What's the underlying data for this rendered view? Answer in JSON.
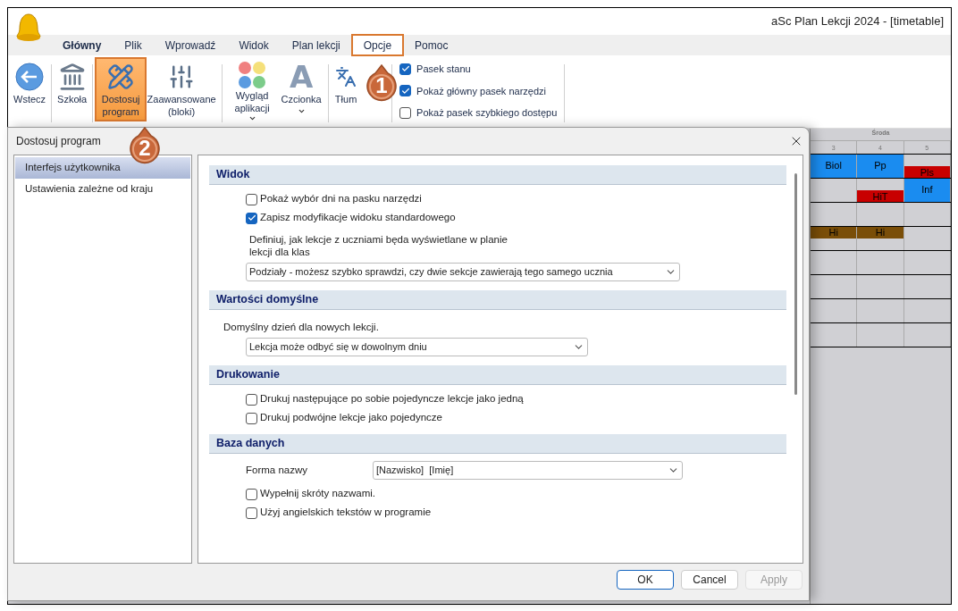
{
  "window": {
    "title": "aSc Plan Lekcji 2024  - [timetable]"
  },
  "ribbon_tabs": [
    {
      "label": "Główny",
      "selected": true,
      "highlighted": false
    },
    {
      "label": "Plik",
      "selected": false,
      "highlighted": false
    },
    {
      "label": "Wprowadź",
      "selected": false,
      "highlighted": false
    },
    {
      "label": "Widok",
      "selected": false,
      "highlighted": false
    },
    {
      "label": "Plan lekcji",
      "selected": false,
      "highlighted": false
    },
    {
      "label": "Opcje",
      "selected": false,
      "highlighted": true
    },
    {
      "label": "Pomoc",
      "selected": false,
      "highlighted": false
    }
  ],
  "ribbon_buttons": [
    {
      "kind": "back",
      "label": "Wstecz",
      "highlighted": false,
      "menu": false
    },
    {
      "kind": "school",
      "label": "Szkoła",
      "highlighted": false,
      "menu": false
    },
    {
      "kind": "customize",
      "label": "Dostosuj program",
      "highlighted": true,
      "menu": false
    },
    {
      "kind": "advanced",
      "label": "Zaawansowane (bloki)",
      "highlighted": false,
      "menu": false
    },
    {
      "kind": "appearance",
      "label": "Wygląd aplikacji",
      "highlighted": false,
      "menu": true
    },
    {
      "kind": "font",
      "label": "Czcionka",
      "glyph": "A",
      "highlighted": false,
      "menu": true
    },
    {
      "kind": "translate",
      "label": "Tłum",
      "highlighted": false,
      "menu": false
    }
  ],
  "ribbon_checkboxes": [
    {
      "label": "Pasek stanu",
      "checked": true
    },
    {
      "label": "Pokaż główny pasek narzędzi",
      "checked": true
    },
    {
      "label": "Pokaż pasek szybkiego dostępu",
      "checked": false
    }
  ],
  "timetable": {
    "day": "Środa",
    "periods": [
      "3",
      "4",
      "5"
    ],
    "rows": [
      [
        {
          "label": "Biol",
          "color": "#1a8cf0",
          "kind": "full"
        },
        {
          "label": "Pp",
          "color": "#1a8cf0",
          "kind": "full"
        },
        {
          "label": "Pls",
          "color": "#c80000",
          "kind": "bottom"
        }
      ],
      [
        {},
        {
          "label": "HiT",
          "color": "#c80000",
          "kind": "bottom"
        },
        {
          "label": "Inf",
          "color": "#1a8cf0",
          "kind": "full"
        }
      ],
      [
        {},
        {},
        {}
      ],
      [
        {
          "label": "Hi",
          "color": "#7a4e08",
          "kind": "top"
        },
        {
          "label": "Hi",
          "color": "#7a4e08",
          "kind": "top"
        },
        {}
      ],
      [
        {},
        {},
        {}
      ],
      [
        {},
        {},
        {}
      ],
      [
        {},
        {},
        {}
      ],
      [
        {},
        {},
        {}
      ]
    ]
  },
  "dialog": {
    "title": "Dostosuj program",
    "nav": [
      {
        "label": "Interfejs użytkownika",
        "selected": true
      },
      {
        "label": "Ustawienia zależne od kraju",
        "selected": false
      }
    ],
    "sections": [
      {
        "title": "Widok",
        "items": [
          {
            "kind": "checkbox",
            "label": "Pokaż wybór dni na pasku narzędzi",
            "checked": false
          },
          {
            "kind": "checkbox",
            "label": "Zapisz modyfikacje widoku standardowego",
            "checked": true
          },
          {
            "kind": "text",
            "text": "Definiuj, jak lekcje z uczniami będa wyświetlane w planie lekcji dla klas",
            "outdent": false
          },
          {
            "kind": "select",
            "value": "Podziały - możesz szybko sprawdzi, czy dwie sekcje zawierają tego samego ucznia",
            "wide": true
          }
        ]
      },
      {
        "title": "Wartości domyślne",
        "items": [
          {
            "kind": "text",
            "text": "Domyślny dzień dla nowych lekcji.",
            "outdent": true
          },
          {
            "kind": "select",
            "value": "Lekcja może odbyć się w dowolnym dniu",
            "wide": false
          }
        ]
      },
      {
        "title": "Drukowanie",
        "items": [
          {
            "kind": "checkbox",
            "label": "Drukuj następujące po sobie pojedyncze lekcje jako jedną",
            "checked": false
          },
          {
            "kind": "checkbox",
            "label": "Drukuj podwójne lekcje jako pojedyncze",
            "checked": false
          }
        ]
      },
      {
        "title": "Baza danych",
        "items": [
          {
            "kind": "labeled_select",
            "label": "Forma nazwy",
            "value": "[Nazwisko]  [Imię]"
          },
          {
            "kind": "checkbox",
            "label": "Wypełnij skróty nazwami.",
            "checked": false
          },
          {
            "kind": "checkbox",
            "label": "Użyj angielskich tekstów w programie",
            "checked": false
          }
        ]
      }
    ],
    "buttons": [
      {
        "label": "OK",
        "default": true,
        "disabled": false
      },
      {
        "label": "Cancel",
        "default": false,
        "disabled": false
      },
      {
        "label": "Apply",
        "default": false,
        "disabled": true
      }
    ]
  },
  "callouts": [
    {
      "number": "1"
    },
    {
      "number": "2"
    }
  ]
}
